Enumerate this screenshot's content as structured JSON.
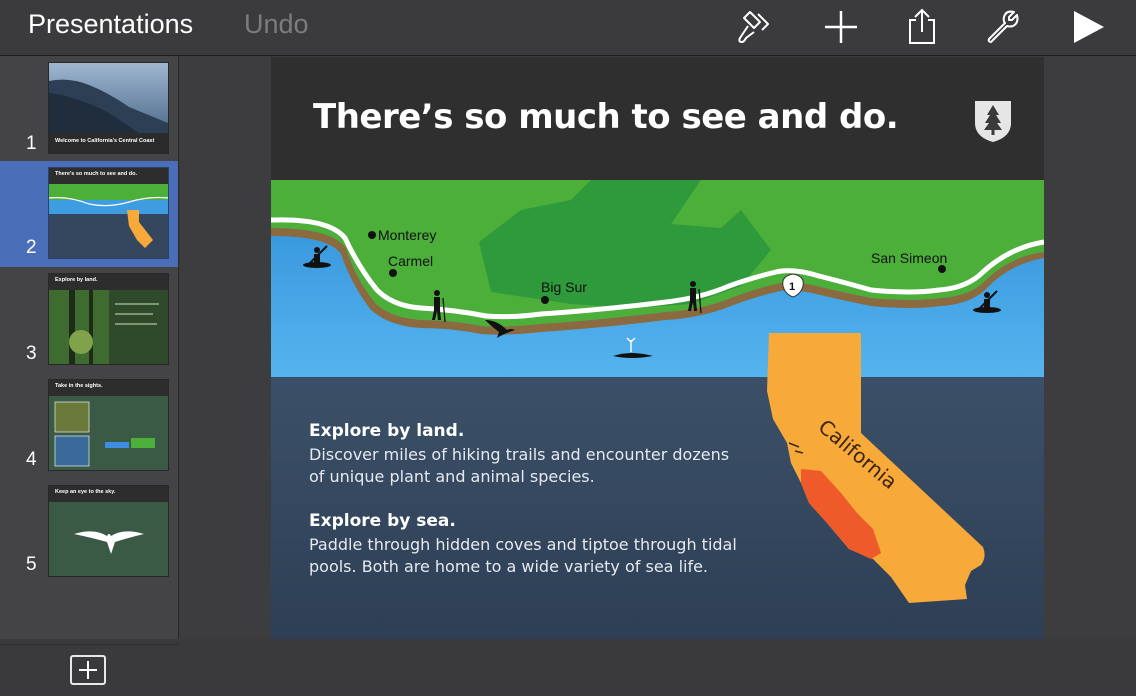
{
  "toolbar": {
    "back_label": "Presentations",
    "undo_label": "Undo",
    "icons": [
      "paintbrush-icon",
      "plus-icon",
      "share-icon",
      "wrench-icon",
      "play-icon"
    ]
  },
  "sidebar": {
    "slides": [
      {
        "number": "1",
        "title": "Welcome to California's Central Coast"
      },
      {
        "number": "2",
        "title": "There's so much to see and do."
      },
      {
        "number": "3",
        "title": "Explore by land."
      },
      {
        "number": "4",
        "title": "Take in the sights."
      },
      {
        "number": "5",
        "title": "Keep an eye to the sky."
      }
    ],
    "selected_index": 1
  },
  "slide": {
    "title": "There’s so much to see and do.",
    "map_labels": {
      "monterey": "Monterey",
      "carmel": "Carmel",
      "big_sur": "Big Sur",
      "san_simeon": "San Simeon",
      "route": "1"
    },
    "state_label": "California",
    "sections": [
      {
        "heading": "Explore by land.",
        "lines": [
          "Discover miles of hiking trails and encounter dozens",
          "of unique plant and animal species."
        ]
      },
      {
        "heading": "Explore by sea.",
        "lines": [
          "Paddle through hidden coves and tiptoe through tidal",
          "pools. Both are home to a wide variety of sea life."
        ]
      }
    ]
  },
  "colors": {
    "selection": "#4a6fb8",
    "land": "#4caf3a",
    "forest": "#2f9a3c",
    "sea": "#3d9de0",
    "california": "#f7a93a",
    "coast_region": "#ef5a2a"
  }
}
